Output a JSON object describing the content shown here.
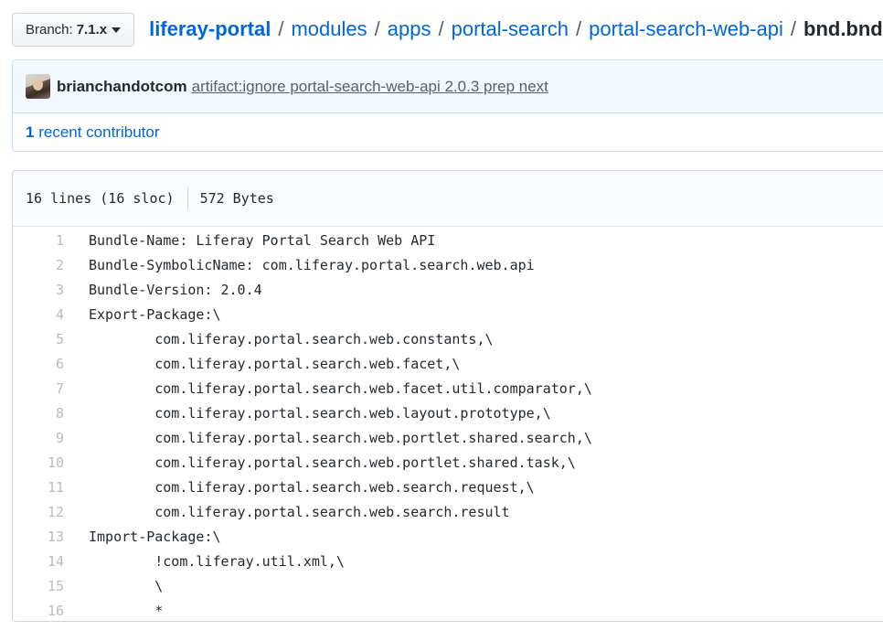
{
  "branch": {
    "label": "Branch:",
    "name": "7.1.x"
  },
  "breadcrumb": {
    "repo": "liferay-portal",
    "parts": [
      "modules",
      "apps",
      "portal-search",
      "portal-search-web-api"
    ],
    "separator": "/",
    "file": "bnd.bnd"
  },
  "commit": {
    "author": "brianchandotcom",
    "message": "artifact:ignore portal-search-web-api 2.0.3 prep next"
  },
  "contributors": {
    "count": "1",
    "label": "recent contributor"
  },
  "file_info": {
    "lines": "16 lines (16 sloc)",
    "size": "572 Bytes"
  },
  "code": [
    {
      "n": "1",
      "text": "Bundle-Name: Liferay Portal Search Web API"
    },
    {
      "n": "2",
      "text": "Bundle-SymbolicName: com.liferay.portal.search.web.api"
    },
    {
      "n": "3",
      "text": "Bundle-Version: 2.0.4"
    },
    {
      "n": "4",
      "text": "Export-Package:\\"
    },
    {
      "n": "5",
      "text": "        com.liferay.portal.search.web.constants,\\"
    },
    {
      "n": "6",
      "text": "        com.liferay.portal.search.web.facet,\\"
    },
    {
      "n": "7",
      "text": "        com.liferay.portal.search.web.facet.util.comparator,\\"
    },
    {
      "n": "8",
      "text": "        com.liferay.portal.search.web.layout.prototype,\\"
    },
    {
      "n": "9",
      "text": "        com.liferay.portal.search.web.portlet.shared.search,\\"
    },
    {
      "n": "10",
      "text": "        com.liferay.portal.search.web.portlet.shared.task,\\"
    },
    {
      "n": "11",
      "text": "        com.liferay.portal.search.web.search.request,\\"
    },
    {
      "n": "12",
      "text": "        com.liferay.portal.search.web.search.result"
    },
    {
      "n": "13",
      "text": "Import-Package:\\"
    },
    {
      "n": "14",
      "text": "        !com.liferay.util.xml,\\"
    },
    {
      "n": "15",
      "text": "        \\"
    },
    {
      "n": "16",
      "text": "        *"
    }
  ]
}
